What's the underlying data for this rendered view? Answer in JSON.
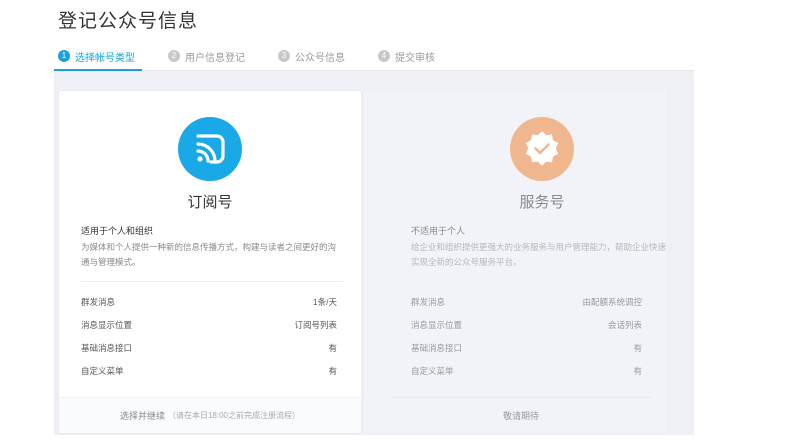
{
  "page": {
    "title": "登记公众号信息"
  },
  "steps": [
    {
      "num": "1",
      "label": "选择帐号类型",
      "active": true
    },
    {
      "num": "2",
      "label": "用户信息登记",
      "active": false
    },
    {
      "num": "3",
      "label": "公众号信息",
      "active": false
    },
    {
      "num": "4",
      "label": "提交审核",
      "active": false
    }
  ],
  "colors": {
    "accent": "#1ba1d7",
    "subscription_icon": "#19a9e6",
    "service_icon": "#f0b78e"
  },
  "cards": {
    "subscription": {
      "icon": "rss-icon",
      "name": "订阅号",
      "desc_title": "适用于个人和组织",
      "desc": "为媒体和个人提供一种新的信息传播方式，构建与读者之间更好的沟通与管理模式。",
      "rows": [
        {
          "label": "群发消息",
          "value": "1条/天"
        },
        {
          "label": "消息显示位置",
          "value": "订阅号列表"
        },
        {
          "label": "基础消息接口",
          "value": "有"
        },
        {
          "label": "自定义菜单",
          "value": "有"
        }
      ],
      "footer_label": "选择并继续",
      "footer_note": "（请在本日18:00之前完成注册流程）"
    },
    "service": {
      "icon": "badge-check-icon",
      "name": "服务号",
      "desc_title": "不适用于个人",
      "desc": "给企业和组织提供更强大的业务服务与用户管理能力，帮助企业快速实现全新的公众号服务平台。",
      "rows": [
        {
          "label": "群发消息",
          "value": "由配额系统调控"
        },
        {
          "label": "消息显示位置",
          "value": "会话列表"
        },
        {
          "label": "基础消息接口",
          "value": "有"
        },
        {
          "label": "自定义菜单",
          "value": "有"
        }
      ],
      "footer_label": "敬请期待"
    }
  }
}
